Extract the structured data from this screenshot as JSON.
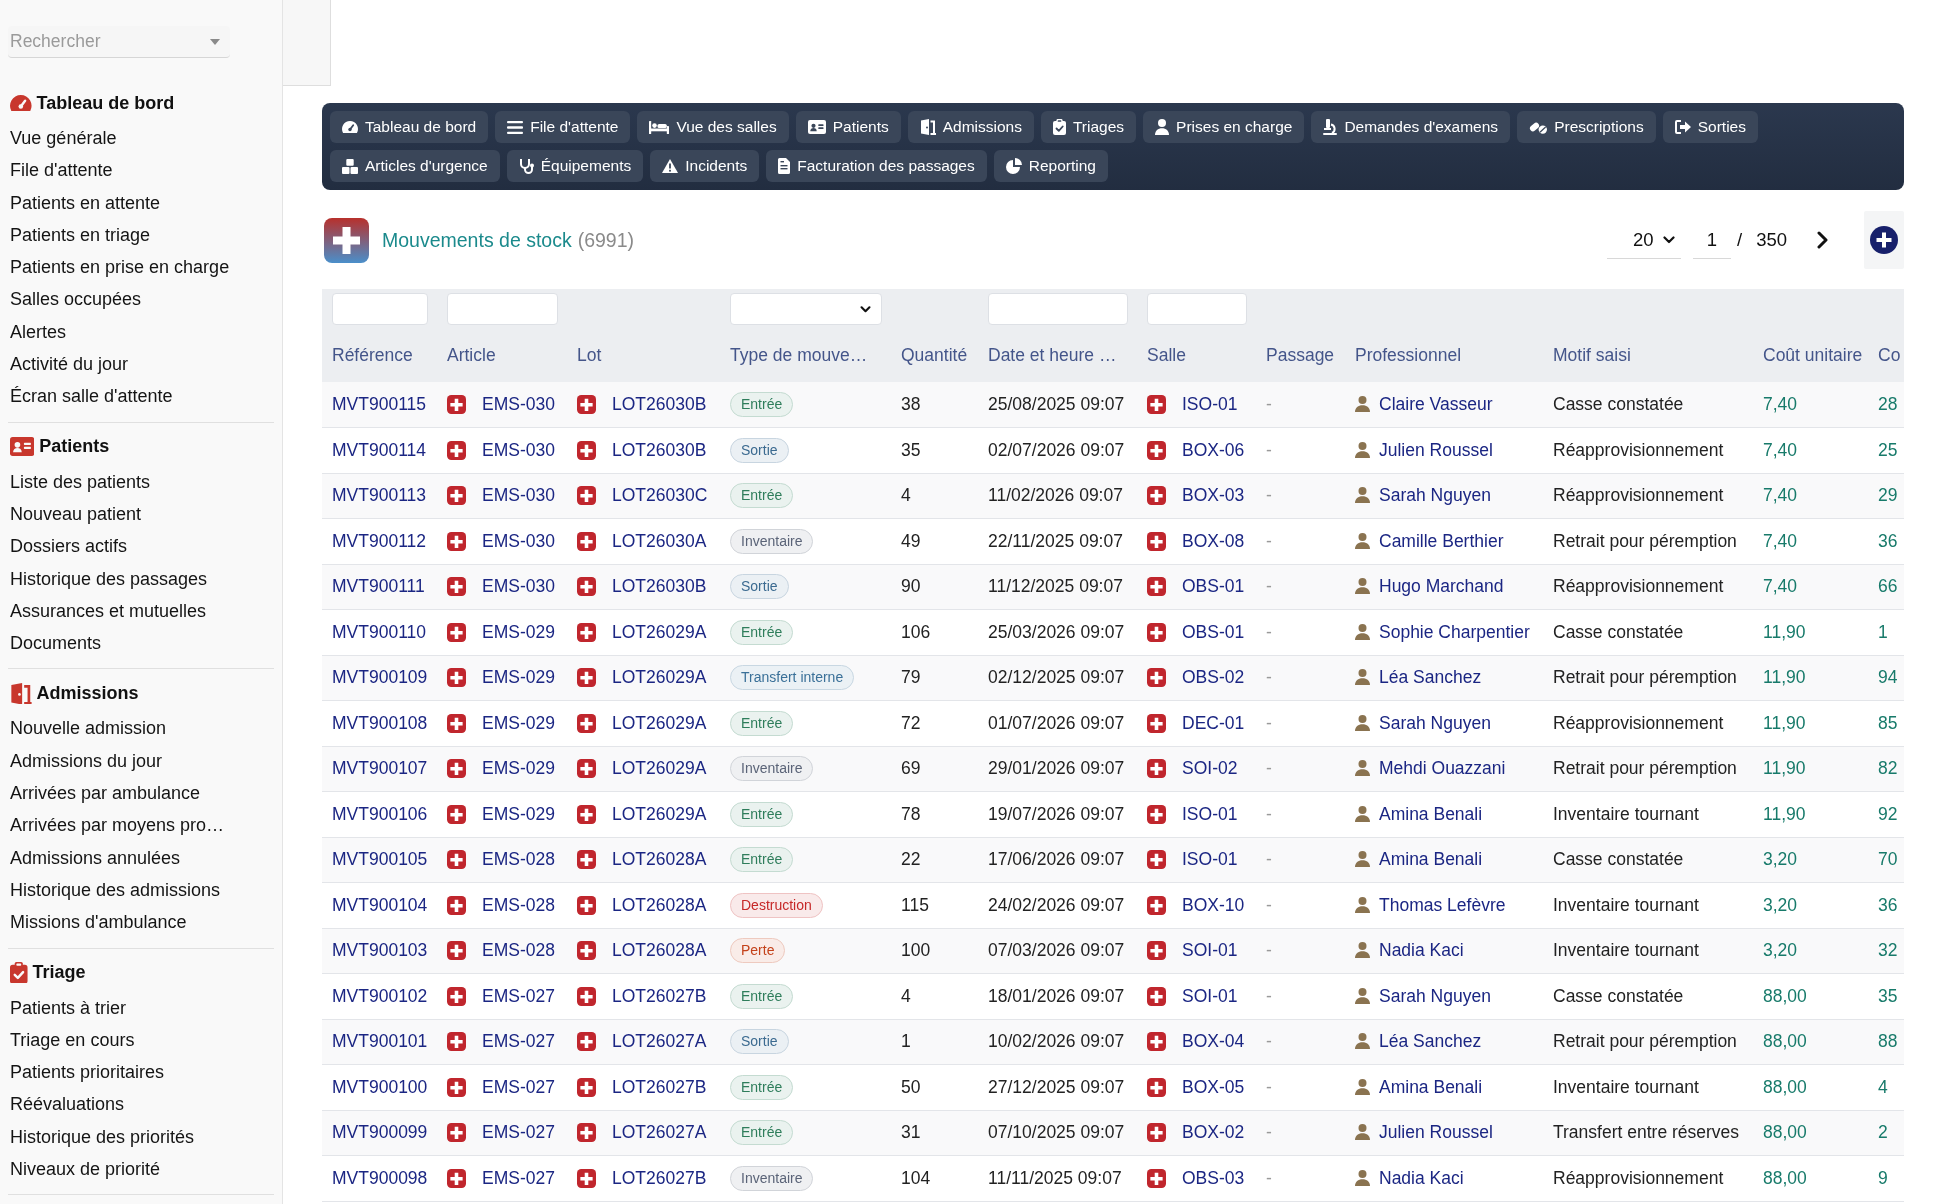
{
  "sidebar": {
    "search": {
      "placeholder": "Rechercher"
    },
    "sections": [
      {
        "title": "Tableau de bord",
        "items": [
          "Vue générale",
          "File d'attente",
          "Patients en attente",
          "Patients en triage",
          "Patients en prise en charge",
          "Salles occupées",
          "Alertes",
          "Activité du jour",
          "Écran salle d'attente"
        ]
      },
      {
        "title": "Patients",
        "items": [
          "Liste des patients",
          "Nouveau patient",
          "Dossiers actifs",
          "Historique des passages",
          "Assurances et mutuelles",
          "Documents"
        ]
      },
      {
        "title": "Admissions",
        "items": [
          "Nouvelle admission",
          "Admissions du jour",
          "Arrivées par ambulance",
          "Arrivées par moyens pro…",
          "Admissions annulées",
          "Historique des admissions",
          "Missions d'ambulance"
        ]
      },
      {
        "title": "Triage",
        "items": [
          "Patients à trier",
          "Triage en cours",
          "Patients prioritaires",
          "Réévaluations",
          "Historique des priorités",
          "Niveaux de priorité"
        ]
      }
    ]
  },
  "nav": [
    "Tableau de bord",
    "File d'attente",
    "Vue des salles",
    "Patients",
    "Admissions",
    "Triages",
    "Prises en charge",
    "Demandes d'examens",
    "Prescriptions",
    "Sorties",
    "Articles d'urgence",
    "Équipements",
    "Incidents",
    "Facturation des passages",
    "Reporting"
  ],
  "page": {
    "title": "Mouvements de stock",
    "count": "(6991)",
    "pagination": {
      "page_size": "20",
      "page": "1",
      "separator": "/",
      "total_pages": "350"
    }
  },
  "table": {
    "columns": [
      {
        "label": "Référence",
        "kind": "text"
      },
      {
        "label": "Article",
        "kind": "text"
      },
      {
        "label": "Lot",
        "kind": "plain"
      },
      {
        "label": "Type de mouve…",
        "kind": "select"
      },
      {
        "label": "Quantité",
        "kind": "plain"
      },
      {
        "label": "Date et heure …",
        "kind": "text"
      },
      {
        "label": "Salle",
        "kind": "text"
      },
      {
        "label": "Passage",
        "kind": "plain"
      },
      {
        "label": "Professionnel",
        "kind": "plain"
      },
      {
        "label": "Motif saisi",
        "kind": "plain"
      },
      {
        "label": "Coût unitaire",
        "kind": "plain"
      },
      {
        "label": "Co",
        "kind": "plain"
      }
    ],
    "rows": [
      {
        "reference": "MVT900115",
        "article": "EMS-030",
        "lot": "LOT26030B",
        "type": {
          "label": "Entrée",
          "color": "#2e7d5b"
        },
        "quantity": "38",
        "date": "25/08/2025 09:07",
        "room": "ISO-01",
        "passage": "-",
        "professional": "Claire Vasseur",
        "reason": "Casse constatée",
        "unit_cost": "7,40",
        "column_12": "28"
      },
      {
        "reference": "MVT900114",
        "article": "EMS-030",
        "lot": "LOT26030B",
        "type": {
          "label": "Sortie",
          "color": "#3b6a90"
        },
        "quantity": "35",
        "date": "02/07/2026 09:07",
        "room": "BOX-06",
        "passage": "-",
        "professional": "Julien Roussel",
        "reason": "Réapprovisionnement",
        "unit_cost": "7,40",
        "column_12": "25"
      },
      {
        "reference": "MVT900113",
        "article": "EMS-030",
        "lot": "LOT26030C",
        "type": {
          "label": "Entrée",
          "color": "#2e7d5b"
        },
        "quantity": "4",
        "date": "11/02/2026 09:07",
        "room": "BOX-03",
        "passage": "-",
        "professional": "Sarah Nguyen",
        "reason": "Réapprovisionnement",
        "unit_cost": "7,40",
        "column_12": "29"
      },
      {
        "reference": "MVT900112",
        "article": "EMS-030",
        "lot": "LOT26030A",
        "type": {
          "label": "Inventaire",
          "color": "#5b6478"
        },
        "quantity": "49",
        "date": "22/11/2025 09:07",
        "room": "BOX-08",
        "passage": "-",
        "professional": "Camille Berthier",
        "reason": "Retrait pour péremption",
        "unit_cost": "7,40",
        "column_12": "36"
      },
      {
        "reference": "MVT900111",
        "article": "EMS-030",
        "lot": "LOT26030B",
        "type": {
          "label": "Sortie",
          "color": "#3b6a90"
        },
        "quantity": "90",
        "date": "11/12/2025 09:07",
        "room": "OBS-01",
        "passage": "-",
        "professional": "Hugo Marchand",
        "reason": "Réapprovisionnement",
        "unit_cost": "7,40",
        "column_12": "66"
      },
      {
        "reference": "MVT900110",
        "article": "EMS-029",
        "lot": "LOT26029A",
        "type": {
          "label": "Entrée",
          "color": "#2e7d5b"
        },
        "quantity": "106",
        "date": "25/03/2026 09:07",
        "room": "OBS-01",
        "passage": "-",
        "professional": "Sophie Charpentier",
        "reason": "Casse constatée",
        "unit_cost": "11,90",
        "column_12": "1"
      },
      {
        "reference": "MVT900109",
        "article": "EMS-029",
        "lot": "LOT26029A",
        "type": {
          "label": "Transfert interne",
          "color": "#3a7098"
        },
        "quantity": "79",
        "date": "02/12/2025 09:07",
        "room": "OBS-02",
        "passage": "-",
        "professional": "Léa Sanchez",
        "reason": "Retrait pour péremption",
        "unit_cost": "11,90",
        "column_12": "94"
      },
      {
        "reference": "MVT900108",
        "article": "EMS-029",
        "lot": "LOT26029A",
        "type": {
          "label": "Entrée",
          "color": "#2e7d5b"
        },
        "quantity": "72",
        "date": "01/07/2026 09:07",
        "room": "DEC-01",
        "passage": "-",
        "professional": "Sarah Nguyen",
        "reason": "Réapprovisionnement",
        "unit_cost": "11,90",
        "column_12": "85"
      },
      {
        "reference": "MVT900107",
        "article": "EMS-029",
        "lot": "LOT26029A",
        "type": {
          "label": "Inventaire",
          "color": "#5b6478"
        },
        "quantity": "69",
        "date": "29/01/2026 09:07",
        "room": "SOI-02",
        "passage": "-",
        "professional": "Mehdi Ouazzani",
        "reason": "Retrait pour péremption",
        "unit_cost": "11,90",
        "column_12": "82"
      },
      {
        "reference": "MVT900106",
        "article": "EMS-029",
        "lot": "LOT26029A",
        "type": {
          "label": "Entrée",
          "color": "#2e7d5b"
        },
        "quantity": "78",
        "date": "19/07/2026 09:07",
        "room": "ISO-01",
        "passage": "-",
        "professional": "Amina Benali",
        "reason": "Inventaire tournant",
        "unit_cost": "11,90",
        "column_12": "92"
      },
      {
        "reference": "MVT900105",
        "article": "EMS-028",
        "lot": "LOT26028A",
        "type": {
          "label": "Entrée",
          "color": "#2e7d5b"
        },
        "quantity": "22",
        "date": "17/06/2026 09:07",
        "room": "ISO-01",
        "passage": "-",
        "professional": "Amina Benali",
        "reason": "Casse constatée",
        "unit_cost": "3,20",
        "column_12": "70"
      },
      {
        "reference": "MVT900104",
        "article": "EMS-028",
        "lot": "LOT26028A",
        "type": {
          "label": "Destruction",
          "color": "#c62828"
        },
        "quantity": "115",
        "date": "24/02/2026 09:07",
        "room": "BOX-10",
        "passage": "-",
        "professional": "Thomas Lefèvre",
        "reason": "Inventaire tournant",
        "unit_cost": "3,20",
        "column_12": "36"
      },
      {
        "reference": "MVT900103",
        "article": "EMS-028",
        "lot": "LOT26028A",
        "type": {
          "label": "Perte",
          "color": "#c4421a"
        },
        "quantity": "100",
        "date": "07/03/2026 09:07",
        "room": "SOI-01",
        "passage": "-",
        "professional": "Nadia Kaci",
        "reason": "Inventaire tournant",
        "unit_cost": "3,20",
        "column_12": "32"
      },
      {
        "reference": "MVT900102",
        "article": "EMS-027",
        "lot": "LOT26027B",
        "type": {
          "label": "Entrée",
          "color": "#2e7d5b"
        },
        "quantity": "4",
        "date": "18/01/2026 09:07",
        "room": "SOI-01",
        "passage": "-",
        "professional": "Sarah Nguyen",
        "reason": "Casse constatée",
        "unit_cost": "88,00",
        "column_12": "35"
      },
      {
        "reference": "MVT900101",
        "article": "EMS-027",
        "lot": "LOT26027A",
        "type": {
          "label": "Sortie",
          "color": "#3b6a90"
        },
        "quantity": "1",
        "date": "10/02/2026 09:07",
        "room": "BOX-04",
        "passage": "-",
        "professional": "Léa Sanchez",
        "reason": "Retrait pour péremption",
        "unit_cost": "88,00",
        "column_12": "88"
      },
      {
        "reference": "MVT900100",
        "article": "EMS-027",
        "lot": "LOT26027B",
        "type": {
          "label": "Entrée",
          "color": "#2e7d5b"
        },
        "quantity": "50",
        "date": "27/12/2025 09:07",
        "room": "BOX-05",
        "passage": "-",
        "professional": "Amina Benali",
        "reason": "Inventaire tournant",
        "unit_cost": "88,00",
        "column_12": "4"
      },
      {
        "reference": "MVT900099",
        "article": "EMS-027",
        "lot": "LOT26027A",
        "type": {
          "label": "Entrée",
          "color": "#2e7d5b"
        },
        "quantity": "31",
        "date": "07/10/2025 09:07",
        "room": "BOX-02",
        "passage": "-",
        "professional": "Julien Roussel",
        "reason": "Transfert entre réserves",
        "unit_cost": "88,00",
        "column_12": "2"
      },
      {
        "reference": "MVT900098",
        "article": "EMS-027",
        "lot": "LOT26027B",
        "type": {
          "label": "Inventaire",
          "color": "#5b6478"
        },
        "quantity": "104",
        "date": "11/11/2025 09:07",
        "room": "OBS-03",
        "passage": "-",
        "professional": "Nadia Kaci",
        "reason": "Réapprovisionnement",
        "unit_cost": "88,00",
        "column_12": "9"
      }
    ]
  }
}
